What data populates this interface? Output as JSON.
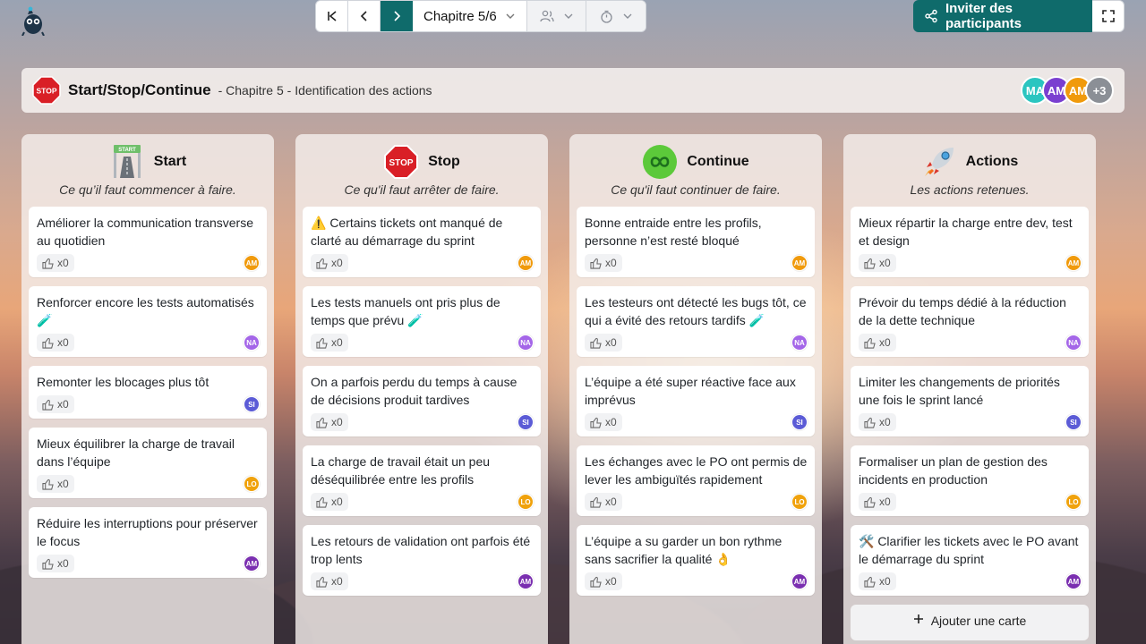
{
  "toolbar": {
    "chapter_label": "Chapitre 5/6",
    "invite_label": "Inviter des participants"
  },
  "header": {
    "title": "Start/Stop/Continue",
    "subtitle": "- Chapitre 5 - Identification des actions",
    "avatars": [
      {
        "initials": "MA",
        "color": "#2bc5c0"
      },
      {
        "initials": "AM",
        "color": "#7a3fd0"
      },
      {
        "initials": "AM",
        "color": "#f09a0c"
      }
    ],
    "extra_count": "+3"
  },
  "avatar_colors": {
    "AM": "#f09a0c",
    "NA": "#a466e8",
    "SI": "#5b5bd6",
    "LO": "#f0a20c",
    "AM2": "#7a2fb0"
  },
  "columns": [
    {
      "name": "Start",
      "desc": "Ce qu’il faut commencer à faire.",
      "cards": [
        {
          "text": "Améliorer la communication transverse au quotidien",
          "likes": "x0",
          "author": "AM",
          "color": "#f09a0c"
        },
        {
          "text": "Renforcer encore les tests automatisés 🧪",
          "likes": "x0",
          "author": "NA",
          "color": "#a466e8"
        },
        {
          "text": "Remonter les blocages plus tôt",
          "likes": "x0",
          "author": "SI",
          "color": "#5b5bd6"
        },
        {
          "text": "Mieux équilibrer la charge de travail dans l’équipe",
          "likes": "x0",
          "author": "LO",
          "color": "#f0a20c"
        },
        {
          "text": "Réduire les interruptions pour préserver le focus",
          "likes": "x0",
          "author": "AM",
          "color": "#7a2fb0"
        }
      ]
    },
    {
      "name": "Stop",
      "desc": "Ce qu'il faut arrêter de faire.",
      "cards": [
        {
          "text": "⚠️ Certains tickets ont manqué de clarté au démarrage du sprint",
          "likes": "x0",
          "author": "AM",
          "color": "#f09a0c"
        },
        {
          "text": "Les tests manuels ont pris plus de temps que prévu 🧪",
          "likes": "x0",
          "author": "NA",
          "color": "#a466e8"
        },
        {
          "text": "On a parfois perdu du temps à cause de décisions produit tardives",
          "likes": "x0",
          "author": "SI",
          "color": "#5b5bd6"
        },
        {
          "text": "La charge de travail était un peu déséquilibrée entre les profils",
          "likes": "x0",
          "author": "LO",
          "color": "#f0a20c"
        },
        {
          "text": "Les retours de validation ont parfois été trop lents",
          "likes": "x0",
          "author": "AM",
          "color": "#7a2fb0"
        }
      ]
    },
    {
      "name": "Continue",
      "desc": "Ce qu'il faut continuer de faire.",
      "cards": [
        {
          "text": "Bonne entraide entre les profils, personne n’est resté bloqué",
          "likes": "x0",
          "author": "AM",
          "color": "#f09a0c"
        },
        {
          "text": "Les testeurs ont détecté les bugs tôt, ce qui a évité des retours tardifs 🧪",
          "likes": "x0",
          "author": "NA",
          "color": "#a466e8"
        },
        {
          "text": "L’équipe a été super réactive face aux imprévus",
          "likes": "x0",
          "author": "SI",
          "color": "#5b5bd6"
        },
        {
          "text": "Les échanges avec le PO ont permis de lever les ambiguïtés rapidement",
          "likes": "x0",
          "author": "LO",
          "color": "#f0a20c"
        },
        {
          "text": "L’équipe a su garder un bon rythme sans sacrifier la qualité 👌",
          "likes": "x0",
          "author": "AM",
          "color": "#7a2fb0"
        }
      ]
    },
    {
      "name": "Actions",
      "desc": "Les actions retenues.",
      "cards": [
        {
          "text": "Mieux répartir la charge entre dev, test et design",
          "likes": "x0",
          "author": "AM",
          "color": "#f09a0c"
        },
        {
          "text": "Prévoir du temps dédié à la réduction de la dette technique",
          "likes": "x0",
          "author": "NA",
          "color": "#a466e8"
        },
        {
          "text": "Limiter les changements de priorités une fois le sprint lancé",
          "likes": "x0",
          "author": "SI",
          "color": "#5b5bd6"
        },
        {
          "text": "Formaliser un plan de gestion des incidents en production",
          "likes": "x0",
          "author": "LO",
          "color": "#f0a20c"
        },
        {
          "text": "🛠️ Clarifier les tickets avec le PO avant le démarrage du sprint",
          "likes": "x0",
          "author": "AM",
          "color": "#7a2fb0"
        }
      ],
      "add_label": "Ajouter une carte"
    }
  ]
}
